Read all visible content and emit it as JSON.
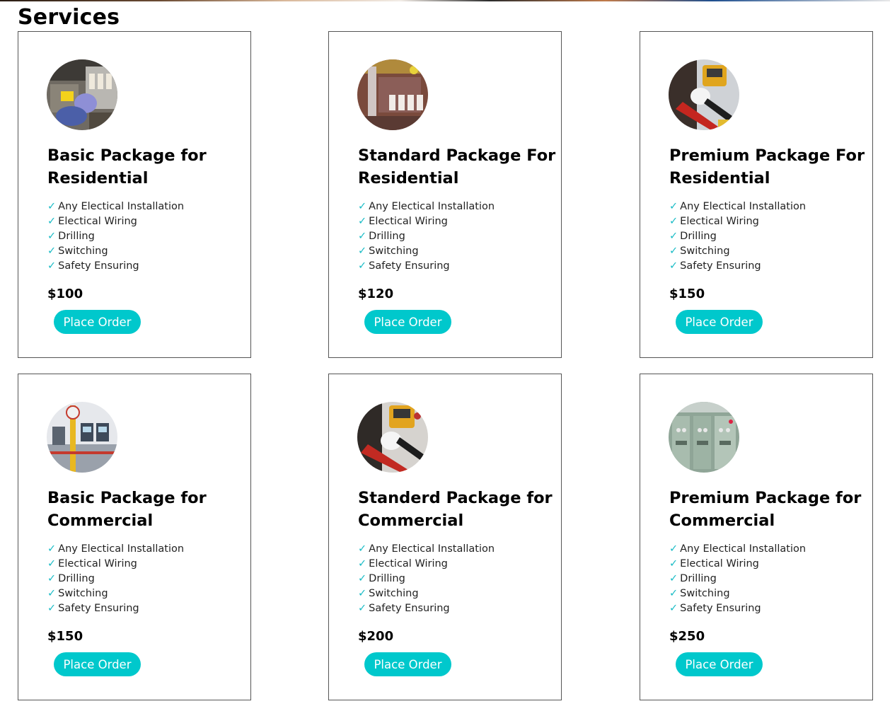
{
  "page": {
    "title": "Services"
  },
  "accent_color": "#00c8cc",
  "check_color": "#1bbcc6",
  "cards": [
    {
      "image": "electrician-panel-photo",
      "title": "Basic Package for Residential",
      "features": [
        "Any Electical Installation",
        "Electical Wiring",
        "Drilling",
        "Switching",
        "Safety Ensuring"
      ],
      "price": "$100",
      "button": "Place Order"
    },
    {
      "image": "breaker-box-photo",
      "title": "Standard Package For Residential",
      "features": [
        "Any Electical Installation",
        "Electical Wiring",
        "Drilling",
        "Switching",
        "Safety Ensuring"
      ],
      "price": "$120",
      "button": "Place Order"
    },
    {
      "image": "multimeter-testing-photo",
      "title": "Premium Package For Residential",
      "features": [
        "Any Electical Installation",
        "Electical Wiring",
        "Drilling",
        "Switching",
        "Safety Ensuring"
      ],
      "price": "$150",
      "button": "Place Order"
    },
    {
      "image": "commercial-meter-panel-photo",
      "title": "Basic Package for Commercial",
      "features": [
        "Any Electical Installation",
        "Electical Wiring",
        "Drilling",
        "Switching",
        "Safety Ensuring"
      ],
      "price": "$150",
      "button": "Place Order"
    },
    {
      "image": "multimeter-gloves-photo",
      "title": "Standerd Package for Commercial",
      "features": [
        "Any Electical Installation",
        "Electical Wiring",
        "Drilling",
        "Switching",
        "Safety Ensuring"
      ],
      "price": "$200",
      "button": "Place Order"
    },
    {
      "image": "industrial-switchgear-photo",
      "title": "Premium Package for Commercial",
      "features": [
        "Any Electical Installation",
        "Electical Wiring",
        "Drilling",
        "Switching",
        "Safety Ensuring"
      ],
      "price": "$250",
      "button": "Place Order"
    }
  ]
}
